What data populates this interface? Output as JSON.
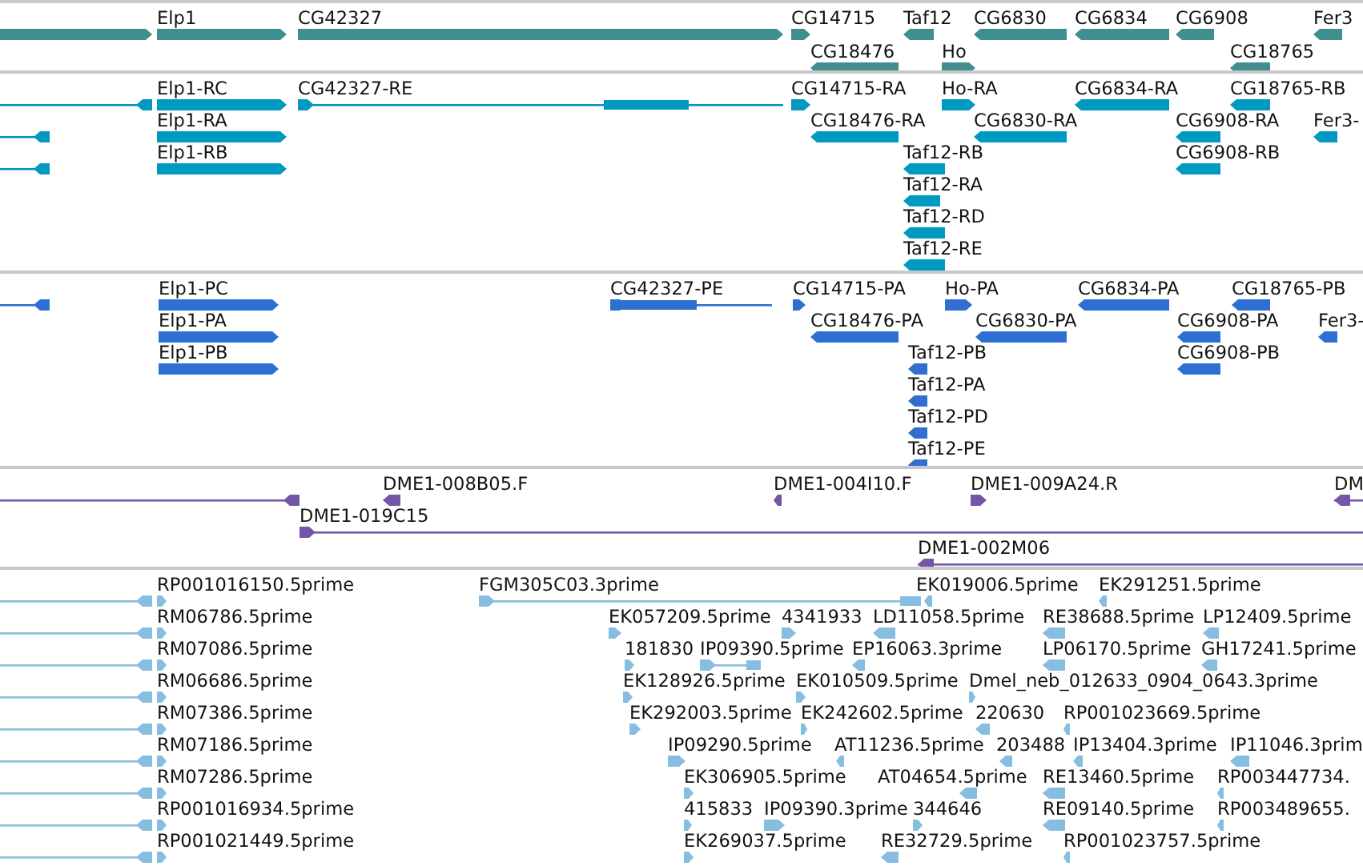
{
  "tracks": [
    {
      "kind": "gene",
      "features": [
        {
          "reverse": false
        },
        {
          "label": "Elp1",
          "reverse": false
        },
        {
          "label": "CG42327",
          "reverse": false
        },
        {
          "label": "CG14715",
          "reverse": false
        },
        {
          "label": "Taf12",
          "reverse": true
        },
        {
          "label": "CG6830",
          "reverse": true
        },
        {
          "label": "CG6834",
          "reverse": true
        },
        {
          "label": "CG6908",
          "reverse": true
        },
        {
          "label": "Fer3",
          "reverse": true
        },
        {
          "label": "CG18476",
          "reverse": true
        },
        {
          "label": "Ho",
          "reverse": false
        },
        {
          "label": "CG18765",
          "reverse": true
        }
      ]
    },
    {
      "kind": "transcript",
      "features": [
        {
          "reverse": true
        },
        {
          "label": "Elp1-RC",
          "reverse": false
        },
        {
          "label": "CG42327-RE",
          "reverse": false
        },
        {
          "label": "CG14715-RA",
          "reverse": false
        },
        {
          "label": "Ho-RA",
          "reverse": false
        },
        {
          "label": "CG6834-RA",
          "reverse": true
        },
        {
          "label": "CG18765-RB",
          "reverse": true
        },
        {
          "reverse": true
        },
        {
          "label": "Elp1-RA",
          "reverse": false
        },
        {
          "label": "CG18476-RA",
          "reverse": true
        },
        {
          "label": "CG6830-RA",
          "reverse": true
        },
        {
          "label": "CG6908-RA",
          "reverse": true
        },
        {
          "label": "Fer3-",
          "reverse": true
        },
        {
          "reverse": true
        },
        {
          "label": "Elp1-RB",
          "reverse": false
        },
        {
          "label": "Taf12-RB",
          "reverse": true
        },
        {
          "label": "CG6908-RB",
          "reverse": true
        },
        {
          "label": "Taf12-RA",
          "reverse": true
        },
        {
          "label": "Taf12-RD",
          "reverse": true
        },
        {
          "label": "Taf12-RE",
          "reverse": true
        }
      ]
    },
    {
      "kind": "protein",
      "features": [
        {
          "reverse": true
        },
        {
          "label": "Elp1-PC",
          "reverse": false
        },
        {
          "label": "CG42327-PE",
          "reverse": false
        },
        {
          "label": "CG14715-PA",
          "reverse": false
        },
        {
          "label": "Ho-PA",
          "reverse": false
        },
        {
          "label": "CG6834-PA",
          "reverse": true
        },
        {
          "label": "CG18765-PB",
          "reverse": true
        },
        {
          "label": "Elp1-PA",
          "reverse": false
        },
        {
          "label": "CG18476-PA",
          "reverse": true
        },
        {
          "label": "CG6830-PA",
          "reverse": true
        },
        {
          "label": "CG6908-PA",
          "reverse": true
        },
        {
          "label": "Fer3-",
          "reverse": true
        },
        {
          "label": "Elp1-PB",
          "reverse": false
        },
        {
          "label": "Taf12-PB",
          "reverse": true
        },
        {
          "label": "CG6908-PB",
          "reverse": true
        },
        {
          "label": "Taf12-PA",
          "reverse": true
        },
        {
          "label": "Taf12-PD",
          "reverse": true
        },
        {
          "label": "Taf12-PE",
          "reverse": true
        }
      ]
    },
    {
      "kind": "clone",
      "features": [
        {
          "reverse": true
        },
        {
          "label": "DME1-008B05.F",
          "reverse": true
        },
        {
          "label": "DME1-004I10.F",
          "reverse": true
        },
        {
          "label": "DME1-009A24.R",
          "reverse": false
        },
        {
          "label": "DM",
          "reverse": true
        },
        {
          "label": "DME1-019C15",
          "reverse": false
        },
        {
          "label": "DME1-002M06",
          "reverse": true
        }
      ]
    },
    {
      "kind": "est",
      "features": [
        {
          "reverse": true
        },
        {
          "label": "RP001016150.5prime",
          "reverse": false
        },
        {
          "label": "FGM305C03.3prime",
          "reverse": false
        },
        {
          "label": "EK019006.5prime",
          "reverse": true
        },
        {
          "label": "EK291251.5prime",
          "reverse": true
        },
        {
          "reverse": true
        },
        {
          "label": "RM06786.5prime",
          "reverse": false
        },
        {
          "label": "EK057209.5prime",
          "reverse": false
        },
        {
          "label": "4341933",
          "reverse": false
        },
        {
          "label": "LD11058.5prime",
          "reverse": true
        },
        {
          "label": "RE38688.5prime",
          "reverse": true
        },
        {
          "label": "LP12409.5prime",
          "reverse": true
        },
        {
          "reverse": true
        },
        {
          "label": "RM07086.5prime",
          "reverse": false
        },
        {
          "label": "181830",
          "reverse": false
        },
        {
          "label": "IP09390.5prime",
          "reverse": false
        },
        {
          "label": "EP16063.3prime",
          "reverse": true
        },
        {
          "label": "LP06170.5prime",
          "reverse": true
        },
        {
          "label": "GH17241.5prime",
          "reverse": true
        },
        {
          "reverse": true
        },
        {
          "label": "RM06686.5prime",
          "reverse": false
        },
        {
          "label": "EK128926.5prime",
          "reverse": false
        },
        {
          "label": "EK010509.5prime",
          "reverse": false
        },
        {
          "label": "Dmel_neb_012633_0904_0643.3prime",
          "reverse": false
        },
        {
          "reverse": true
        },
        {
          "label": "RM07386.5prime",
          "reverse": false
        },
        {
          "label": "EK292003.5prime",
          "reverse": false
        },
        {
          "label": "EK242602.5prime",
          "reverse": false
        },
        {
          "label": "220630",
          "reverse": true
        },
        {
          "label": "RP001023669.5prime",
          "reverse": true
        },
        {
          "reverse": true
        },
        {
          "label": "RM07186.5prime",
          "reverse": false
        },
        {
          "label": "IP09290.5prime",
          "reverse": false
        },
        {
          "label": "AT11236.5prime",
          "reverse": true
        },
        {
          "label": "203488",
          "reverse": true
        },
        {
          "label": "IP13404.3prime",
          "reverse": true
        },
        {
          "label": "IP11046.3prim",
          "reverse": true
        },
        {
          "reverse": true
        },
        {
          "label": "RM07286.5prime",
          "reverse": false
        },
        {
          "label": "EK306905.5prime",
          "reverse": false
        },
        {
          "label": "AT04654.5prime",
          "reverse": true
        },
        {
          "label": "RE13460.5prime",
          "reverse": true
        },
        {
          "label": "RP003447734.",
          "reverse": true
        },
        {
          "reverse": true
        },
        {
          "label": "RP001016934.5prime",
          "reverse": false
        },
        {
          "label": "415833",
          "reverse": false
        },
        {
          "label": "IP09390.3prime",
          "reverse": false
        },
        {
          "label": "344646",
          "reverse": false
        },
        {
          "label": "RE09140.5prime",
          "reverse": true
        },
        {
          "label": "RP003489655.",
          "reverse": true
        },
        {
          "reverse": true
        },
        {
          "label": "RP001021449.5prime",
          "reverse": false
        },
        {
          "label": "EK269037.5prime",
          "reverse": false
        },
        {
          "label": "RE32729.5prime",
          "reverse": true
        },
        {
          "label": "RP001023757.5prime",
          "reverse": true
        }
      ]
    }
  ]
}
